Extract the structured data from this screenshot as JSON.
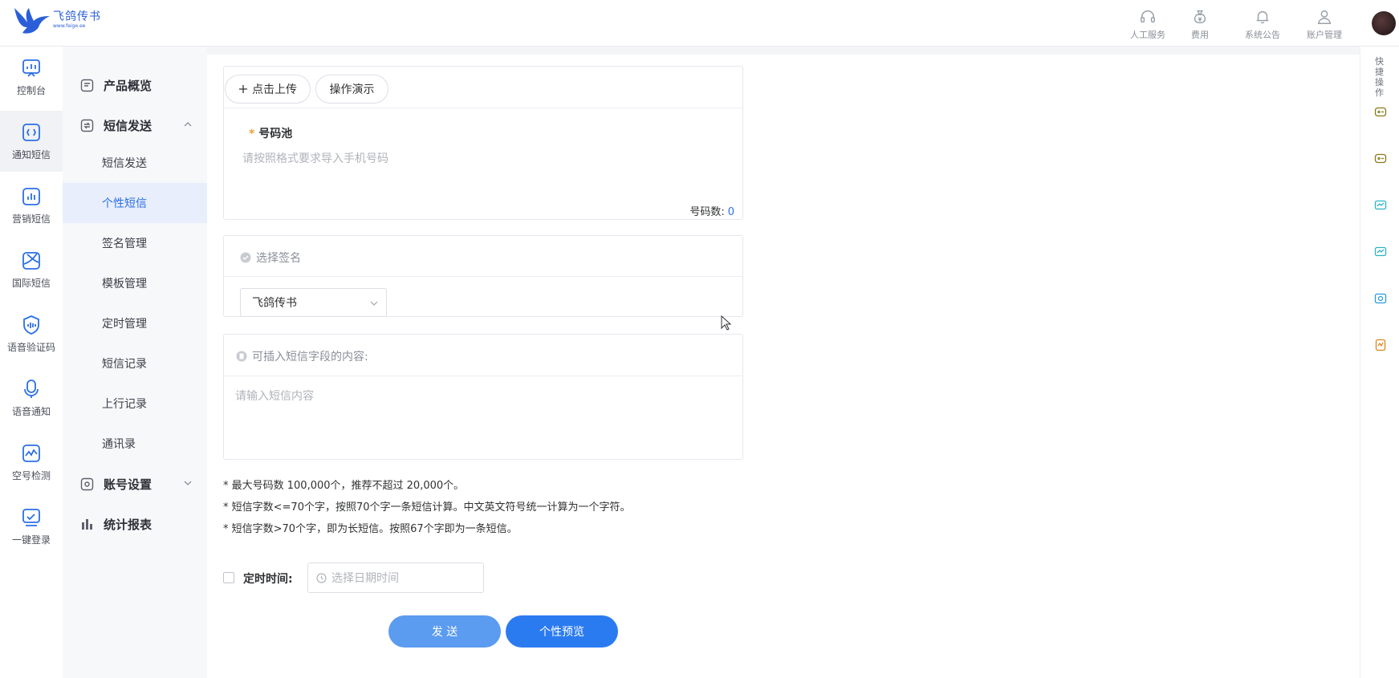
{
  "header": {
    "logo_name": "飞鸽传书",
    "logo_url": "www.feige.ee",
    "nav": [
      {
        "label": "人工服务",
        "icon": "headset-icon"
      },
      {
        "label": "费用",
        "icon": "money-bag-icon"
      },
      {
        "label": "系统公告",
        "icon": "bell-icon"
      },
      {
        "label": "账户管理",
        "icon": "user-icon"
      }
    ]
  },
  "rail": {
    "items": [
      {
        "label": "控制台",
        "icon": "dashboard-icon"
      },
      {
        "label": "通知短信",
        "icon": "notice-sms-icon"
      },
      {
        "label": "营销短信",
        "icon": "marketing-sms-icon"
      },
      {
        "label": "国际短信",
        "icon": "globe-sms-icon"
      },
      {
        "label": "语音验证码",
        "icon": "voice-code-icon"
      },
      {
        "label": "语音通知",
        "icon": "microphone-icon"
      },
      {
        "label": "空号检测",
        "icon": "pulse-icon"
      },
      {
        "label": "一键登录",
        "icon": "one-click-login-icon"
      }
    ],
    "active_index": 1
  },
  "menu": {
    "overview": "产品概览",
    "sms_send_group": "短信发送",
    "sub_items": [
      "短信发送",
      "个性短信",
      "签名管理",
      "模板管理",
      "定时管理",
      "短信记录",
      "上行记录",
      "通讯录"
    ],
    "active_sub": "个性短信",
    "account_settings": "账号设置",
    "reports": "统计报表"
  },
  "upload_card": {
    "upload_label": "点击上传",
    "demo_label": "操作演示",
    "pool_star": "*",
    "pool_label": "号码池",
    "pool_placeholder": "请按照格式要求导入手机号码",
    "count_label": "号码数:",
    "count_value": "0"
  },
  "signature_card": {
    "title": "选择签名",
    "selected": "飞鸽传书"
  },
  "content_card": {
    "title": "可插入短信字段的内容:",
    "placeholder": "请输入短信内容"
  },
  "notes": [
    "* 最大号码数 100,000个，推荐不超过 20,000个。",
    "* 短信字数<=70个字，按照70个字一条短信计算。中文英文符号统一计算为一个字符。",
    "* 短信字数>70个字，即为长短信。按照67个字即为一条短信。"
  ],
  "schedule": {
    "label": "定时时间:",
    "placeholder": "选择日期时间"
  },
  "actions": {
    "send": "发 送",
    "preview": "个性预览"
  },
  "quick": {
    "label": "快捷操作",
    "icons": [
      {
        "name": "quick-sms-icon-1",
        "color": "#8a7a1a"
      },
      {
        "name": "quick-sms-icon-2",
        "color": "#8a7a1a"
      },
      {
        "name": "quick-chat-icon-1",
        "color": "#2bb3c7"
      },
      {
        "name": "quick-chat-icon-2",
        "color": "#2bb3c7"
      },
      {
        "name": "quick-voice-icon",
        "color": "#2b9be0"
      },
      {
        "name": "quick-doc-icon",
        "color": "#d98a1a"
      }
    ]
  },
  "colors": {
    "accent": "#2b6fe6",
    "send_button": "#5b9bf0",
    "preview_button": "#2b7bf0"
  }
}
